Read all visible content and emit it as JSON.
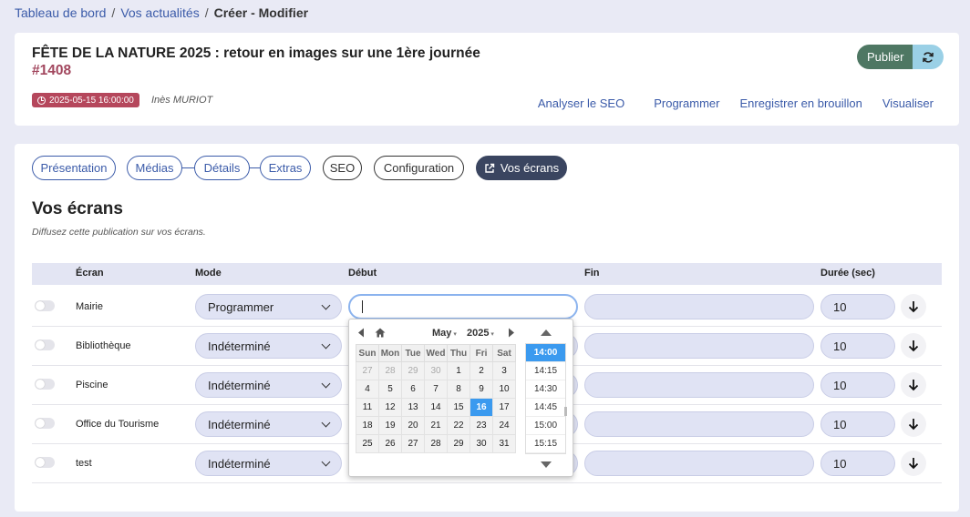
{
  "breadcrumb": {
    "items": [
      "Tableau de bord",
      "Vos actualités",
      "Créer - Modifier"
    ],
    "separator": "/"
  },
  "post": {
    "title": "FÊTE DE LA NATURE 2025 : retour en images sur une 1ère journée",
    "id": "#1408",
    "date": "2025-05-15 16:00:00",
    "author": "Inès MURIOT",
    "publish_label": "Publier"
  },
  "actions": [
    "Analyser le SEO",
    "Programmer",
    "Enregistrer en brouillon",
    "Visualiser"
  ],
  "tabs": [
    "Présentation",
    "Médias",
    "Détails",
    "Extras",
    "SEO",
    "Configuration",
    "Vos écrans"
  ],
  "section": {
    "title": "Vos écrans",
    "subtitle": "Diffusez cette publication sur vos écrans."
  },
  "table": {
    "headers": [
      "Écran",
      "Mode",
      "Début",
      "Fin",
      "Durée (sec)"
    ],
    "rows": [
      {
        "name": "Mairie",
        "mode": "Programmer",
        "duration": "10"
      },
      {
        "name": "Bibliothèque",
        "mode": "Indéterminé",
        "duration": "10"
      },
      {
        "name": "Piscine",
        "mode": "Indéterminé",
        "duration": "10"
      },
      {
        "name": "Office du Tourisme",
        "mode": "Indéterminé",
        "duration": "10"
      },
      {
        "name": "test",
        "mode": "Indéterminé",
        "duration": "10"
      }
    ]
  },
  "datepicker": {
    "month": "May",
    "year": "2025",
    "weekdays": [
      "Sun",
      "Mon",
      "Tue",
      "Wed",
      "Thu",
      "Fri",
      "Sat"
    ],
    "weeks": [
      [
        "27",
        "28",
        "29",
        "30",
        "1",
        "2",
        "3"
      ],
      [
        "4",
        "5",
        "6",
        "7",
        "8",
        "9",
        "10"
      ],
      [
        "11",
        "12",
        "13",
        "14",
        "15",
        "16",
        "17"
      ],
      [
        "18",
        "19",
        "20",
        "21",
        "22",
        "23",
        "24"
      ],
      [
        "25",
        "26",
        "27",
        "28",
        "29",
        "30",
        "31"
      ]
    ],
    "selected_day": "16",
    "times": [
      "14:00",
      "14:15",
      "14:30",
      "14:45",
      "15:00",
      "15:15"
    ],
    "selected_time": "14:00"
  },
  "colors": {
    "accent": "#3b5ba9",
    "publish": "#4e7763",
    "badge": "#b5475c",
    "selected": "#3b9aef"
  }
}
